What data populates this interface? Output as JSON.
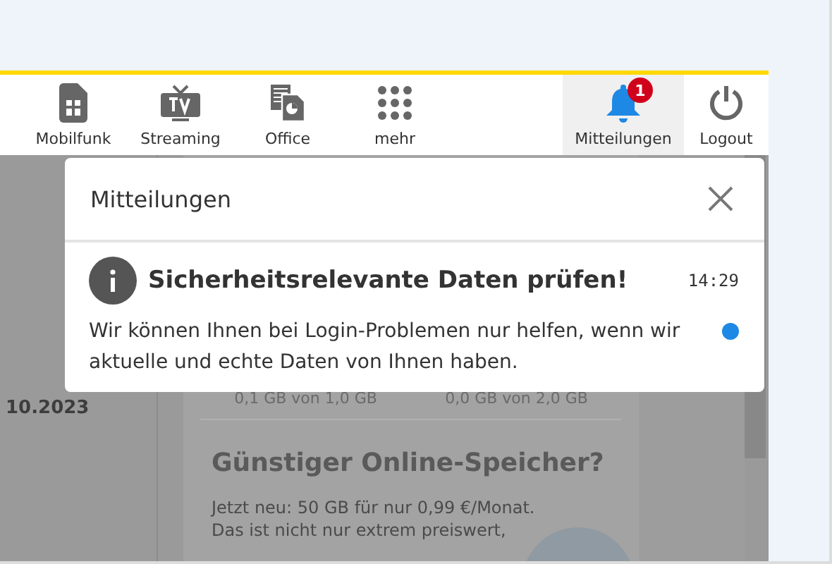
{
  "nav": {
    "items": [
      {
        "kind": "sim",
        "label": "Mobilfunk",
        "selected": false
      },
      {
        "kind": "tv",
        "label": "Streaming",
        "selected": false
      },
      {
        "kind": "documents",
        "label": "Office",
        "selected": false
      },
      {
        "kind": "grid",
        "label": "mehr",
        "selected": false
      },
      {
        "kind": "bell",
        "label": "Mitteilungen",
        "selected": true,
        "badge": "1"
      },
      {
        "kind": "power",
        "label": "Logout",
        "selected": false
      }
    ]
  },
  "background": {
    "date": "10.2023",
    "usage": [
      "0,1 GB von 1,0 GB",
      "0,0 GB von 2,0 GB"
    ],
    "promo_title": "Günstiger Online-Speicher?",
    "promo_lines": [
      "Jetzt neu:  50 GB für nur 0,99 €/Monat.",
      "Das ist nicht nur extrem preiswert,"
    ]
  },
  "dialog": {
    "title": "Mitteilungen",
    "notifications": [
      {
        "title": "Sicherheitsrelevante Daten prüfen!",
        "time": "14:29",
        "text": "Wir können Ihnen bei Login-Problemen nur helfen, wenn wir aktuelle und echte Daten von Ihnen haben.",
        "unread": true
      }
    ]
  }
}
